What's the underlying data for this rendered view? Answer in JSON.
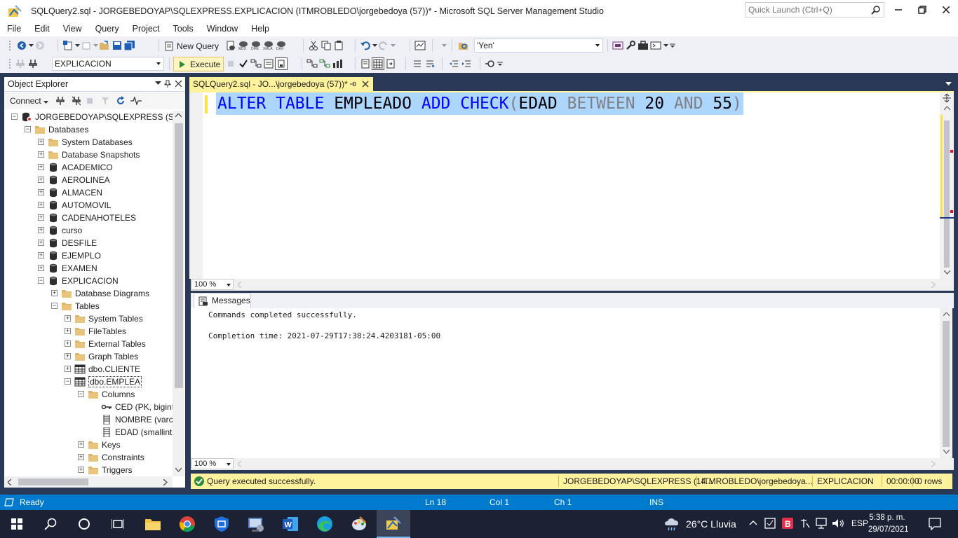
{
  "window": {
    "title": "SQLQuery2.sql - JORGEBEDOYAP\\SQLEXPRESS.EXPLICACION (ITMROBLEDO\\jorgebedoya (57))* - Microsoft SQL Server Management Studio",
    "quick_launch_placeholder": "Quick Launch (Ctrl+Q)"
  },
  "menu": [
    "File",
    "Edit",
    "View",
    "Query",
    "Project",
    "Tools",
    "Window",
    "Help"
  ],
  "toolbar": {
    "new_query_label": "New Query",
    "solution_config": "'Yen'",
    "database_select": "EXPLICACION",
    "execute_label": "Execute"
  },
  "object_explorer": {
    "title": "Object Explorer",
    "connect_label": "Connect",
    "tree": [
      {
        "label": "JORGEBEDOYAP\\SQLEXPRESS (SQL S",
        "icon": "server-icon",
        "expander": "-"
      },
      {
        "label": "Databases",
        "icon": "folder-icon",
        "expander": "-"
      },
      {
        "label": "System Databases",
        "icon": "folder-icon",
        "expander": "+"
      },
      {
        "label": "Database Snapshots",
        "icon": "folder-icon",
        "expander": "+"
      },
      {
        "label": "ACADEMICO",
        "icon": "database-icon",
        "expander": "+"
      },
      {
        "label": "AEROLINEA",
        "icon": "database-icon",
        "expander": "+"
      },
      {
        "label": "ALMACEN",
        "icon": "database-icon",
        "expander": "+"
      },
      {
        "label": "AUTOMOVIL",
        "icon": "database-icon",
        "expander": "+"
      },
      {
        "label": "CADENAHOTELES",
        "icon": "database-icon",
        "expander": "+"
      },
      {
        "label": "curso",
        "icon": "database-icon",
        "expander": "+"
      },
      {
        "label": "DESFILE",
        "icon": "database-icon",
        "expander": "+"
      },
      {
        "label": "EJEMPLO",
        "icon": "database-icon",
        "expander": "+"
      },
      {
        "label": "EXAMEN",
        "icon": "database-icon",
        "expander": "+"
      },
      {
        "label": "EXPLICACION",
        "icon": "database-icon",
        "expander": "-"
      },
      {
        "label": "Database Diagrams",
        "icon": "folder-icon",
        "expander": "+"
      },
      {
        "label": "Tables",
        "icon": "folder-icon",
        "expander": "-"
      },
      {
        "label": "System Tables",
        "icon": "folder-icon",
        "expander": "+"
      },
      {
        "label": "FileTables",
        "icon": "folder-icon",
        "expander": "+"
      },
      {
        "label": "External Tables",
        "icon": "folder-icon",
        "expander": "+"
      },
      {
        "label": "Graph Tables",
        "icon": "folder-icon",
        "expander": "+"
      },
      {
        "label": "dbo.CLIENTE",
        "icon": "table-icon",
        "expander": "+"
      },
      {
        "label": "dbo.EMPLEA",
        "icon": "table-icon",
        "expander": "-"
      },
      {
        "label": "Columns",
        "icon": "folder-icon",
        "expander": "-"
      },
      {
        "label": "CED (PK, bigint",
        "icon": "key-icon",
        "expander": ""
      },
      {
        "label": "NOMBRE (varc",
        "icon": "column-icon",
        "expander": ""
      },
      {
        "label": "EDAD (smallint",
        "icon": "column-icon",
        "expander": ""
      },
      {
        "label": "Keys",
        "icon": "folder-icon",
        "expander": "+"
      },
      {
        "label": "Constraints",
        "icon": "folder-icon",
        "expander": "+"
      },
      {
        "label": "Triggers",
        "icon": "folder-icon",
        "expander": "+"
      }
    ]
  },
  "document": {
    "tab_label": "SQLQuery2.sql - JO...\\jorgebedoya (57))*",
    "code_tokens": [
      {
        "text": "ALTER",
        "style": "kw"
      },
      {
        "text": " ",
        "style": "tx"
      },
      {
        "text": "TABLE",
        "style": "kw"
      },
      {
        "text": " EMPLEADO ",
        "style": "tx"
      },
      {
        "text": "ADD",
        "style": "kw"
      },
      {
        "text": " ",
        "style": "tx"
      },
      {
        "text": "CHECK",
        "style": "kw"
      },
      {
        "text": "(",
        "style": "gr"
      },
      {
        "text": "EDAD ",
        "style": "tx"
      },
      {
        "text": "BETWEEN",
        "style": "gr"
      },
      {
        "text": " 20 ",
        "style": "tx"
      },
      {
        "text": "AND",
        "style": "gr"
      },
      {
        "text": " 55",
        "style": "tx"
      },
      {
        "text": ")",
        "style": "gr"
      }
    ],
    "editor_zoom": "100 %"
  },
  "results": {
    "tab_label": "Messages",
    "line1": "Commands completed successfully.",
    "line2": "Completion time: 2021-07-29T17:38:24.4203181-05:00",
    "zoom": "100 %"
  },
  "query_status": {
    "message": "Query executed successfully.",
    "server": "JORGEBEDOYAP\\SQLEXPRESS (14...",
    "user": "ITMROBLEDO\\jorgebedoya...",
    "database": "EXPLICACION",
    "elapsed": "00:00:00",
    "rows": "0 rows"
  },
  "statusbar": {
    "state": "Ready",
    "ln": "Ln 18",
    "col": "Col 1",
    "ch": "Ch 1",
    "mode": "INS"
  },
  "taskbar": {
    "weather": "26°C  Lluvia",
    "language": "ESP",
    "time": "5:38 p. m.",
    "date": "29/07/2021"
  },
  "colors": {
    "accent": "#007acc",
    "tab_active": "#fff29d",
    "keyword": "#0000ff",
    "selection": "#add6ff"
  }
}
